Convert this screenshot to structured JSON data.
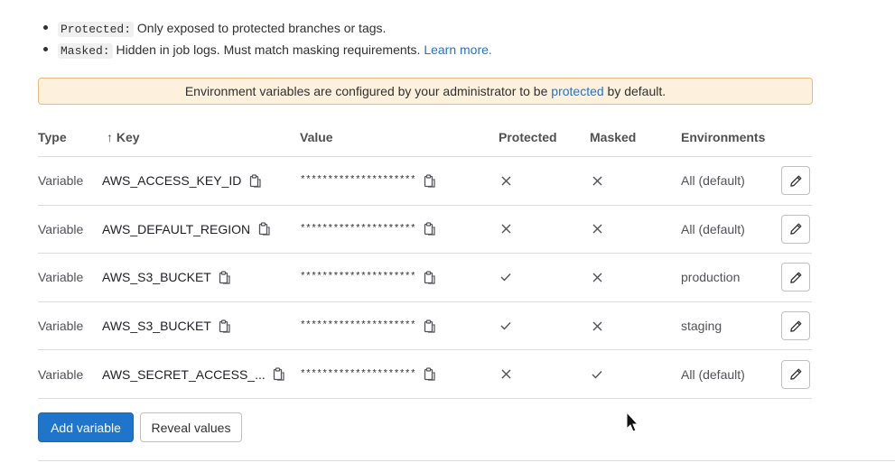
{
  "info": {
    "protected_term": "Protected:",
    "protected_desc": " Only exposed to protected branches or tags.",
    "masked_term": "Masked:",
    "masked_desc": " Hidden in job logs. Must match masking requirements. ",
    "learn_more": "Learn more."
  },
  "alert": {
    "before": "Environment variables are configured by your administrator to be ",
    "link": "protected",
    "after": " by default."
  },
  "table": {
    "headers": {
      "type": "Type",
      "sort_arrow": "↑",
      "key": "Key",
      "value": "Value",
      "protected": "Protected",
      "masked": "Masked",
      "environments": "Environments"
    },
    "rows": [
      {
        "type": "Variable",
        "key": "AWS_ACCESS_KEY_ID",
        "value": "*********************",
        "protected": "no",
        "masked": "no",
        "environment": "All (default)"
      },
      {
        "type": "Variable",
        "key": "AWS_DEFAULT_REGION",
        "value": "*********************",
        "protected": "no",
        "masked": "no",
        "environment": "All (default)"
      },
      {
        "type": "Variable",
        "key": "AWS_S3_BUCKET",
        "value": "*********************",
        "protected": "yes",
        "masked": "no",
        "environment": "production"
      },
      {
        "type": "Variable",
        "key": "AWS_S3_BUCKET",
        "value": "*********************",
        "protected": "yes",
        "masked": "no",
        "environment": "staging"
      },
      {
        "type": "Variable",
        "key": "AWS_SECRET_ACCESS_...",
        "value": "*********************",
        "protected": "no",
        "masked": "yes",
        "environment": "All (default)"
      }
    ]
  },
  "actions": {
    "add_variable": "Add variable",
    "reveal_values": "Reveal values"
  },
  "colors": {
    "primary": "#1f75cb",
    "alert_bg": "#fdf1dd",
    "alert_border": "#e9be74",
    "divider": "#dcdcde"
  },
  "icons": {
    "copy": "copy-to-clipboard-icon",
    "edit": "pencil-icon",
    "check": "check-icon",
    "close": "close-icon",
    "cursor": "mouse-pointer-icon"
  }
}
